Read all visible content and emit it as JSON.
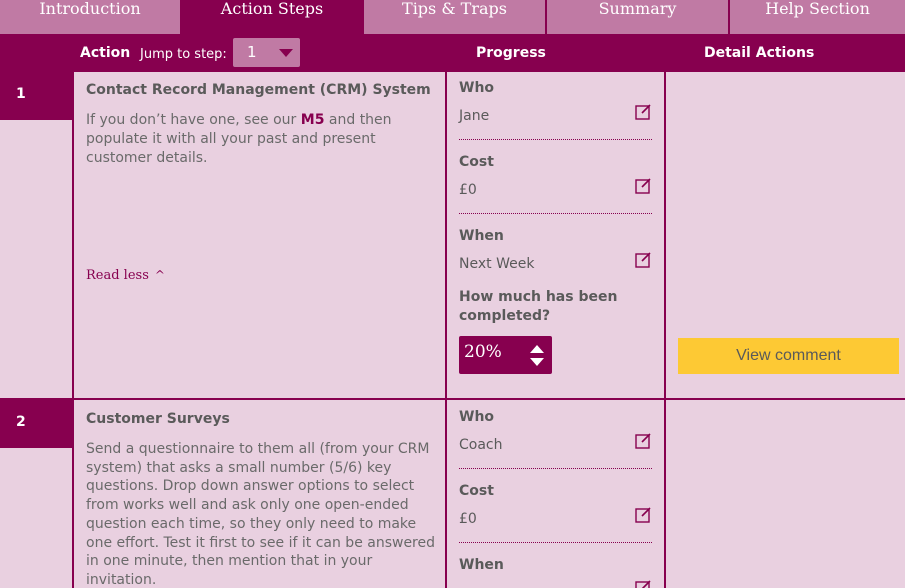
{
  "tabs": [
    {
      "label": "Introduction"
    },
    {
      "label": "Action Steps"
    },
    {
      "label": "Tips & Traps"
    },
    {
      "label": "Summary"
    },
    {
      "label": "Help Section"
    }
  ],
  "header": {
    "action": "Action",
    "jump_label": "Jump to step:",
    "jump_value": "1",
    "progress": "Progress",
    "detail_actions": "Detail Actions"
  },
  "steps": [
    {
      "number": "1",
      "title": "Contact Record Management (CRM) System",
      "desc_before": "If you don’t have one, see our ",
      "desc_link": "M5",
      "desc_after": " and then populate it with all your past and present customer details.",
      "read_less": "Read less",
      "who_label": "Who",
      "who_value": "Jane",
      "cost_label": "Cost",
      "cost_value": "£0",
      "when_label": "When",
      "when_value": "Next Week",
      "completed_label": "How much has been completed?",
      "completed_value": "20%",
      "view_comment": "View comment"
    },
    {
      "number": "2",
      "title": "Customer Surveys",
      "desc": "Send a questionnaire to them all (from your CRM system) that asks a small number (5/6) key questions. Drop down answer options to select from works well and ask only one open-ended question each time, so they only need to make one effort. Test it first to see if it can be answered in one minute, then mention that in your invitation.",
      "who_label": "Who",
      "who_value": "Coach",
      "cost_label": "Cost",
      "cost_value": "£0",
      "when_label": "When"
    }
  ]
}
